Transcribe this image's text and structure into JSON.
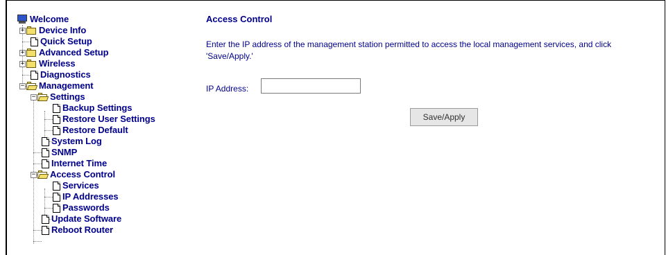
{
  "tree": {
    "welcome": "Welcome",
    "device_info": "Device Info",
    "quick_setup": "Quick Setup",
    "advanced_setup": "Advanced Setup",
    "wireless": "Wireless",
    "diagnostics": "Diagnostics",
    "management": "Management",
    "settings": "Settings",
    "backup_settings": "Backup Settings",
    "restore_user_settings": "Restore User Settings",
    "restore_default": "Restore Default",
    "system_log": "System Log",
    "snmp": "SNMP",
    "internet_time": "Internet Time",
    "access_control": "Access Control",
    "services": "Services",
    "ip_addresses": "IP Addresses",
    "passwords": "Passwords",
    "update_software": "Update Software",
    "reboot_router": "Reboot Router",
    "expander_plus": "+",
    "expander_minus": "−"
  },
  "main": {
    "title": "Access Control",
    "instructions": "Enter the IP address of the management station permitted to access the local management services, and click 'Save/Apply.'",
    "ip_label": "IP Address:",
    "ip_value": "",
    "save_button": "Save/Apply"
  },
  "colors": {
    "link": "#00008b",
    "folder": "#f2de6a"
  },
  "icons": {
    "root": "monitor-icon",
    "folder": "folder-icon",
    "open_folder": "folder-open-icon",
    "page": "page-icon"
  }
}
